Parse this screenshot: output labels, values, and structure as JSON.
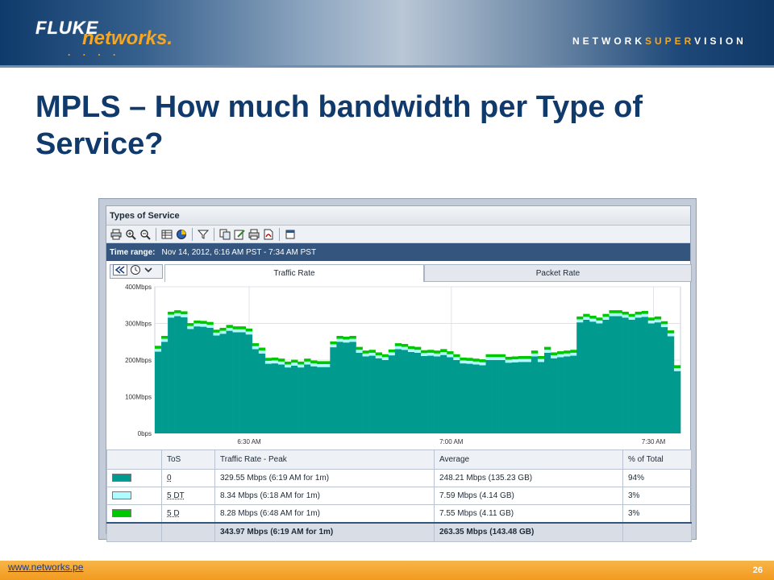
{
  "brand": {
    "logo_fluke": "FLUKE",
    "logo_networks": "networks.",
    "logo_dots": ". . . .",
    "tagline_pre": "NETWORK",
    "tagline_accent": "SUPER",
    "tagline_post": "VISION",
    "accent_color": "#f5a623",
    "navy_color": "#0f3a6b"
  },
  "slide": {
    "title": "MPLS – How much bandwidth per Type of Service?"
  },
  "panel": {
    "title": "Types of Service",
    "toolbar_icons": [
      "print-icon",
      "zoom-in-icon",
      "zoom-out-icon",
      "table-icon",
      "chart-icon",
      "filter-icon",
      "copy-icon",
      "edit-icon",
      "print-preview-icon",
      "pdf-icon",
      "window-icon"
    ],
    "time_range_label": "Time range:",
    "time_range_value": "Nov 14, 2012, 6:16 AM PST - 7:34 AM PST",
    "tabs": [
      {
        "label": "Traffic Rate",
        "active": true
      },
      {
        "label": "Packet Rate",
        "active": false
      }
    ]
  },
  "chart_data": {
    "type": "area",
    "title": "",
    "ylabel": "",
    "xlabel": "",
    "y_ticks": [
      "400Mbps",
      "300Mbps",
      "200Mbps",
      "100Mbps",
      "0bps"
    ],
    "ylim": [
      0,
      400
    ],
    "x_ticks": [
      "6:30 AM",
      "7:00 AM",
      "7:30 AM"
    ],
    "x_tick_minutes": [
      14,
      44,
      74
    ],
    "xlim_minutes": [
      0,
      78
    ],
    "series": [
      {
        "name": "0",
        "color": "#009a8e",
        "values": [
          223,
          250,
          316,
          320,
          317,
          285,
          292,
          291,
          288,
          267,
          272,
          280,
          276,
          276,
          270,
          230,
          218,
          190,
          191,
          188,
          180,
          185,
          180,
          188,
          183,
          181,
          181,
          235,
          250,
          248,
          250,
          220,
          210,
          212,
          205,
          200,
          213,
          230,
          228,
          222,
          220,
          211,
          212,
          210,
          214,
          208,
          200,
          191,
          190,
          188,
          186,
          200,
          200,
          200,
          193,
          194,
          195,
          195,
          210,
          195,
          220,
          205,
          208,
          210,
          212,
          303,
          310,
          305,
          300,
          310,
          320,
          320,
          316,
          310,
          316,
          318,
          300,
          303,
          290,
          265,
          170
        ]
      },
      {
        "name": "5 DT",
        "color": "#aefcff",
        "values": [
          8,
          8,
          8,
          8,
          8,
          8,
          8,
          8,
          8,
          8,
          8,
          8,
          8,
          8,
          8,
          8,
          8,
          8,
          8,
          8,
          8,
          8,
          8,
          8,
          8,
          8,
          8,
          8,
          8,
          8,
          8,
          8,
          8,
          8,
          8,
          8,
          8,
          8,
          8,
          8,
          8,
          8,
          8,
          8,
          8,
          8,
          8,
          8,
          8,
          8,
          8,
          8,
          8,
          8,
          8,
          8,
          8,
          8,
          8,
          8,
          8,
          8,
          8,
          8,
          8,
          8,
          8,
          8,
          8,
          8,
          8,
          8,
          8,
          8,
          8,
          8,
          8,
          8,
          8,
          8,
          8
        ]
      },
      {
        "name": "5 D",
        "color": "#00c800",
        "values": [
          8,
          8,
          8,
          8,
          8,
          8,
          8,
          8,
          8,
          8,
          8,
          8,
          8,
          8,
          8,
          8,
          8,
          8,
          8,
          8,
          8,
          8,
          8,
          8,
          8,
          8,
          8,
          8,
          8,
          8,
          8,
          8,
          8,
          8,
          8,
          8,
          8,
          8,
          8,
          8,
          8,
          8,
          8,
          8,
          8,
          8,
          8,
          8,
          8,
          8,
          8,
          8,
          8,
          8,
          8,
          8,
          8,
          8,
          8,
          8,
          8,
          8,
          8,
          8,
          8,
          8,
          8,
          8,
          8,
          8,
          8,
          8,
          8,
          8,
          8,
          8,
          8,
          8,
          8,
          8,
          8
        ]
      }
    ],
    "grid": true,
    "legend": "table-below"
  },
  "table": {
    "headers": [
      "ToS",
      "Traffic Rate - Peak",
      "Average",
      "% of Total"
    ],
    "rows": [
      {
        "color": "#009a8e",
        "tos": "0",
        "peak": "329.55 Mbps (6:19 AM for 1m)",
        "average": "248.21 Mbps (135.23 GB)",
        "percent": "94%"
      },
      {
        "color": "#aefcff",
        "tos": "5 DT",
        "peak": "8.34 Mbps (6:18 AM for 1m)",
        "average": "7.59 Mbps (4.14 GB)",
        "percent": "3%"
      },
      {
        "color": "#00c800",
        "tos": "5 D",
        "peak": "8.28 Mbps (6:48 AM for 1m)",
        "average": "7.55 Mbps (4.11 GB)",
        "percent": "3%"
      }
    ],
    "total": {
      "peak": "343.97 Mbps (6:19 AM for 1m)",
      "average": "263.35 Mbps (143.48 GB)"
    }
  },
  "footer": {
    "link": "www.networks.pe",
    "page_number": "26"
  }
}
